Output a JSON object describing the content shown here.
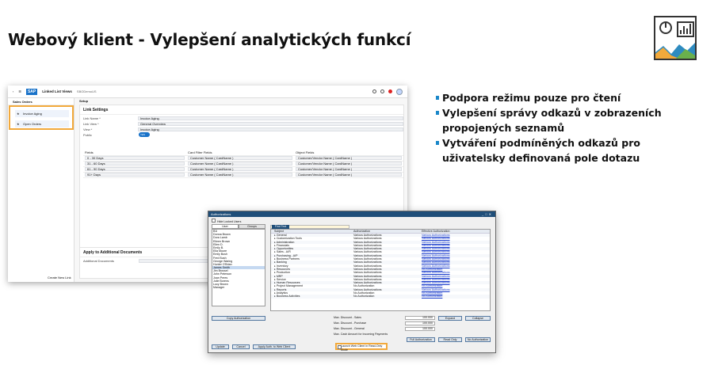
{
  "slide": {
    "title": "Webový klient - Vylepšení analytických funkcí",
    "bullets": [
      "Podpora režimu pouze pro čtení",
      "Vylepšení správy odkazů v zobrazeních propojených seznamů",
      "Vytváření podmíněných odkazů pro uživatelsky definovaná pole dotazu"
    ]
  },
  "sap": {
    "logo": "SAP",
    "app_title": "Linked List Views",
    "company": "SBODemoUS",
    "sidebar_title": "Sales Orders",
    "sidebar_items": [
      "Invoice Aging",
      "Open Orders"
    ],
    "create_link": "Create New Link",
    "breadcrumb": "Setup",
    "section_title": "Link Settings",
    "fields": [
      {
        "label": "Link Name *",
        "value": "Invoice Aging"
      },
      {
        "label": "Link View *",
        "value": "General Overview"
      },
      {
        "label": "View *",
        "value": "Invoice Aging"
      }
    ],
    "public_label": "Public",
    "public_value": "YES",
    "table_headers": [
      "Fields",
      "Card Filter Fields",
      "Object Fields"
    ],
    "table_rows": [
      [
        "0 - 30 Days",
        "Customer Name ( CardName )",
        "Customer/Vendor Name ( CardName )"
      ],
      [
        "31 - 60 Days",
        "Customer Name ( CardName )",
        "Customer/Vendor Name ( CardName )"
      ],
      [
        "61 - 90 Days",
        "Customer Name ( CardName )",
        "Customer/Vendor Name ( CardName )"
      ],
      [
        "91+ Days",
        "Customer Name ( CardName )",
        "Customer/Vendor Name ( CardName )"
      ]
    ],
    "apply_title": "Apply to Additional Documents",
    "apply_label": "Additional Documents"
  },
  "auth": {
    "title": "Authorizations",
    "hide_locked": "Hide Locked Users",
    "tabs": [
      "User",
      "Groups"
    ],
    "users": [
      "B1i",
      "Donna Brown",
      "Dora Lamb",
      "Eileen Brown",
      "Ellen D.",
      "Emily B.",
      "Ella Moore",
      "Emily Bush",
      "Fred Bush",
      "George Waring",
      "Hunter O'Brian",
      "James Smith",
      "Jim Brossel",
      "John Peterson",
      "Joan Peres",
      "Julie Borens",
      "Lucy Brown",
      "Manager"
    ],
    "copy_btn": "Copy Authorization",
    "find_label": "Find Text",
    "columns": [
      "Subject",
      "Authorization",
      "Effective Authorization"
    ],
    "rows": [
      [
        "General",
        "Various Authorizations",
        "Various Authorizations"
      ],
      [
        "Customization Tools",
        "Various Authorizations",
        "Various Authorizations"
      ],
      [
        "Administration",
        "Various Authorizations",
        "Various Authorizations"
      ],
      [
        "Financials",
        "Various Authorizations",
        "Various Authorizations"
      ],
      [
        "Opportunities",
        "Various Authorizations",
        "Various Authorizations"
      ],
      [
        "Sales - A/R",
        "Various Authorizations",
        "Various Authorizations"
      ],
      [
        "Purchasing - A/P",
        "Various Authorizations",
        "Various Authorizations"
      ],
      [
        "Business Partners",
        "Various Authorizations",
        "Various Authorizations"
      ],
      [
        "Banking",
        "Various Authorizations",
        "Various Authorizations"
      ],
      [
        "Inventory",
        "Various Authorizations",
        "Various Authorizations"
      ],
      [
        "Resources",
        "Various Authorizations",
        "No Authorization"
      ],
      [
        "Production",
        "Various Authorizations",
        "Various Authorizations"
      ],
      [
        "MRP",
        "Various Authorizations",
        "Various Authorizations"
      ],
      [
        "Service",
        "Various Authorizations",
        "Various Authorizations"
      ],
      [
        "Human Resources",
        "Various Authorizations",
        "Various Authorizations"
      ],
      [
        "Project Management",
        "No Authorization",
        "No Authorization"
      ],
      [
        "Reports",
        "Various Authorizations",
        "Various Authorizations"
      ],
      [
        "Analytics",
        "No Authorization",
        "No Authorization"
      ],
      [
        "Business Activities",
        "No Authorization",
        "No Authorization"
      ]
    ],
    "discounts": [
      {
        "label": "Max. Discount - Sales",
        "value": "100.000"
      },
      {
        "label": "Max. Discount - Purchase",
        "value": "100.000"
      },
      {
        "label": "Max. Discount - General",
        "value": "100.000"
      }
    ],
    "max_cash": "Max. Cash Amount for Incoming Payments",
    "btn_expand": "Expand",
    "btn_collapse": "Collapse",
    "btn_full": "Full Authorization",
    "btn_read": "Read Only",
    "btn_no": "No Authorization",
    "btn_update": "Update",
    "btn_cancel": "Cancel",
    "btn_apply": "Apply Auth. to Web Client",
    "launch": "Launch Web Client in Read-Only Mode"
  }
}
